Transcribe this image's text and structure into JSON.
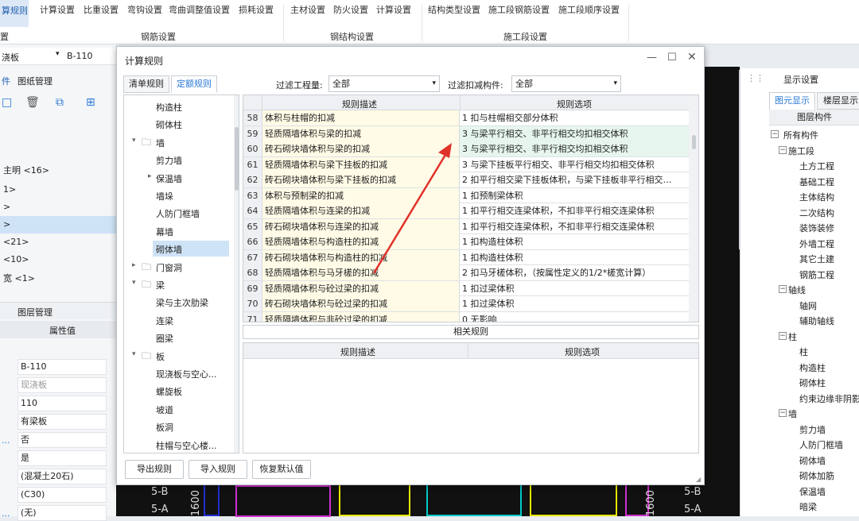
{
  "ribbon": {
    "active_tab": "算规则",
    "tools": [
      "计算设置",
      "比重设置",
      "弯钩设置",
      "弯曲调整值设置",
      "损耗设置",
      "主材设置",
      "防火设置",
      "计算设置",
      "结构类型设置",
      "施工段钢筋设置",
      "施工段顺序设置"
    ],
    "groups": [
      "置",
      "钢筋设置",
      "钢结构设置",
      "施工段设置"
    ]
  },
  "left_panel": {
    "selector1": "浇板",
    "selector2": "B-110",
    "tabs": [
      "件",
      "图纸管理"
    ],
    "tree": [
      "主明 <16>",
      "1>",
      ">",
      ">",
      "<21>",
      "<10>",
      "宽 <1>"
    ],
    "layer_tabs": [
      "图层管理"
    ],
    "prop_header": "属性值",
    "props": [
      "B-110",
      "现浇板",
      "110",
      "有梁板",
      "否",
      "是",
      "(混凝土20石)",
      "(C30)",
      "(无)"
    ],
    "side_marks": [
      "...",
      "..."
    ]
  },
  "cad": {
    "axis_labels": [
      "5-B",
      "5-A",
      "5-B",
      "5-A"
    ],
    "dims": [
      "1600",
      "1600"
    ]
  },
  "right_panel": {
    "title": "显示设置",
    "tabs": [
      "图元显示",
      "楼层显示"
    ],
    "col_header": "图层构件",
    "items": [
      {
        "label": "所有构件",
        "level": 0,
        "box": "minus"
      },
      {
        "label": "施工段",
        "level": 1,
        "box": "minus"
      },
      {
        "label": "土方工程",
        "level": 2
      },
      {
        "label": "基础工程",
        "level": 2
      },
      {
        "label": "主体结构",
        "level": 2
      },
      {
        "label": "二次结构",
        "level": 2
      },
      {
        "label": "装饰装修",
        "level": 2
      },
      {
        "label": "外墙工程",
        "level": 2
      },
      {
        "label": "其它土建",
        "level": 2
      },
      {
        "label": "钢筋工程",
        "level": 2
      },
      {
        "label": "轴线",
        "level": 1,
        "box": "minus"
      },
      {
        "label": "轴网",
        "level": 2
      },
      {
        "label": "辅助轴线",
        "level": 2
      },
      {
        "label": "柱",
        "level": 1,
        "box": "minus"
      },
      {
        "label": "柱",
        "level": 2
      },
      {
        "label": "构造柱",
        "level": 2
      },
      {
        "label": "砌体柱",
        "level": 2
      },
      {
        "label": "约束边缘非阴影",
        "level": 2
      },
      {
        "label": "墙",
        "level": 1,
        "box": "minus"
      },
      {
        "label": "剪力墙",
        "level": 2
      },
      {
        "label": "人防门框墙",
        "level": 2
      },
      {
        "label": "砌体墙",
        "level": 2
      },
      {
        "label": "砌体加筋",
        "level": 2
      },
      {
        "label": "保温墙",
        "level": 2
      },
      {
        "label": "暗梁",
        "level": 2
      }
    ]
  },
  "dialog": {
    "title": "计算规则",
    "tabs": [
      "清单规则",
      "定额规则"
    ],
    "active_tab": 1,
    "filter1_label": "过滤工程量:",
    "filter1_value": "全部",
    "filter2_label": "过滤扣减构件:",
    "filter2_value": "全部",
    "tree": [
      {
        "label": "构造柱",
        "level": 1
      },
      {
        "label": "砌体柱",
        "level": 1
      },
      {
        "label": "墙",
        "level": 0,
        "toggle": "open",
        "folder": true
      },
      {
        "label": "剪力墙",
        "level": 1
      },
      {
        "label": "保温墙",
        "level": 1,
        "toggle": "closed"
      },
      {
        "label": "墙垛",
        "level": 1
      },
      {
        "label": "人防门框墙",
        "level": 1
      },
      {
        "label": "幕墙",
        "level": 1
      },
      {
        "label": "砌体墙",
        "level": 1,
        "selected": true
      },
      {
        "label": "门窗洞",
        "level": 0,
        "toggle": "closed",
        "folder": true
      },
      {
        "label": "梁",
        "level": 0,
        "toggle": "open",
        "folder": true
      },
      {
        "label": "梁与主次肋梁",
        "level": 1
      },
      {
        "label": "连梁",
        "level": 1
      },
      {
        "label": "圈梁",
        "level": 1
      },
      {
        "label": "板",
        "level": 0,
        "toggle": "open",
        "folder": true
      },
      {
        "label": "现浇板与空心...",
        "level": 1
      },
      {
        "label": "螺旋板",
        "level": 1
      },
      {
        "label": "坡道",
        "level": 1
      },
      {
        "label": "板洞",
        "level": 1
      },
      {
        "label": "柱帽与空心楼...",
        "level": 1
      }
    ],
    "grid_headers": [
      "规则描述",
      "规则选项"
    ],
    "rows": [
      {
        "no": "58",
        "desc": "体积与柱帽的扣减",
        "opt": "1 扣与柱帽相交部分体积"
      },
      {
        "no": "59",
        "desc": "轻质隔墙体积与梁的扣减",
        "opt": "3  与梁平行相交、非平行相交均扣相交体积",
        "hl": true
      },
      {
        "no": "60",
        "desc": "砖石砌块墙体积与梁的扣减",
        "opt": "3  与梁平行相交、非平行相交均扣相交体积",
        "hl": true
      },
      {
        "no": "61",
        "desc": "轻质隔墙体积与梁下挂板的扣减",
        "opt": "3  与梁下挂板平行相交、非平行相交均扣相交体积"
      },
      {
        "no": "62",
        "desc": "砖石砌块墙体积与梁下挂板的扣减",
        "opt": "2  扣平行相交梁下挂板体积，与梁下挂板非平行相交…"
      },
      {
        "no": "63",
        "desc": "体积与预制梁的扣减",
        "opt": "1  扣预制梁体积"
      },
      {
        "no": "64",
        "desc": "轻质隔墙体积与连梁的扣减",
        "opt": "1  扣平行相交连梁体积，不扣非平行相交连梁体积"
      },
      {
        "no": "65",
        "desc": "砖石砌块墙体积与连梁的扣减",
        "opt": "1  扣平行相交连梁体积，不扣非平行相交连梁体积"
      },
      {
        "no": "66",
        "desc": "轻质隔墙体积与构造柱的扣减",
        "opt": "1  扣构造柱体积"
      },
      {
        "no": "67",
        "desc": "砖石砌块墙体积与构造柱的扣减",
        "opt": "1  扣构造柱体积"
      },
      {
        "no": "68",
        "desc": "轻质隔墙体积与马牙槎的扣减",
        "opt": "2  扣马牙槎体积，（按属性定义的1/2*槎宽计算）"
      },
      {
        "no": "69",
        "desc": "轻质隔墙体积与砼过梁的扣减",
        "opt": "1  扣过梁体积"
      },
      {
        "no": "70",
        "desc": "砖石砌块墙体积与砼过梁的扣减",
        "opt": "1  扣过梁体积"
      },
      {
        "no": "71",
        "desc": "轻质隔墙体积与非砼过梁的扣减",
        "opt": "0  无影响"
      }
    ],
    "related_title": "相关规则",
    "related_headers": [
      "规则描述",
      "规则选项"
    ],
    "buttons": [
      "导出规则",
      "导入规则",
      "恢复默认值"
    ]
  },
  "colors": {
    "accent": "#2b78d6",
    "selection": "#cfe3f7",
    "arrow": "#e0322a"
  }
}
